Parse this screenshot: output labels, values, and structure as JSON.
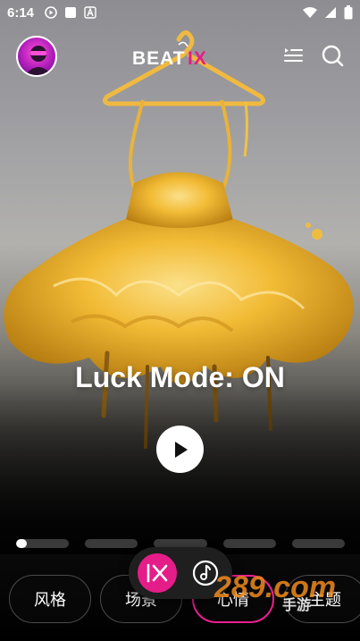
{
  "status_bar": {
    "time": "6:14",
    "left_icons": [
      "play-circle-icon",
      "square-app-icon",
      "a-font-icon"
    ],
    "right_icons": [
      "wifi-icon",
      "cellular-signal-icon",
      "battery-icon"
    ]
  },
  "header": {
    "logo_text": "BEATIX",
    "logo_accent_color": "#e51d88",
    "right_icons": [
      "playlist-icon",
      "search-icon"
    ]
  },
  "hero": {
    "headline": "Luck Mode: ON"
  },
  "pager": {
    "segments": 5,
    "active_index": 0,
    "active_progress": 0.2
  },
  "tabs": [
    {
      "label": "风格",
      "active": false
    },
    {
      "label": "场景",
      "active": false
    },
    {
      "label": "心情",
      "active": true
    },
    {
      "label": "主题",
      "active": false
    }
  ],
  "floating_bar": {
    "left_icon": "ix-logo-icon",
    "right_icon": "music-note-circle-icon"
  },
  "watermark": {
    "text": "289.com",
    "subtext": "手游"
  },
  "colors": {
    "accent": "#e51d88",
    "dress_yellow": "#f3c33e"
  }
}
